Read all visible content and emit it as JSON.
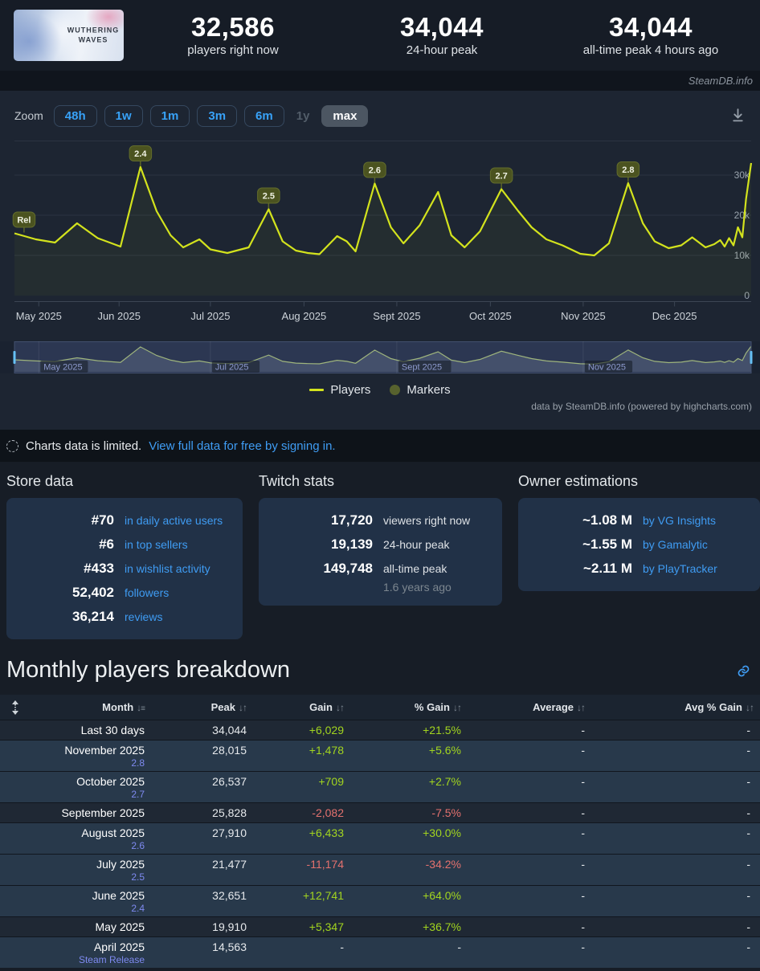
{
  "header": {
    "game_title": "WUTHERING WAVES",
    "watermark": "SteamDB.info",
    "stats": [
      {
        "value": "32,586",
        "label": "players right now"
      },
      {
        "value": "34,044",
        "label": "24-hour peak"
      },
      {
        "value": "34,044",
        "label": "all-time peak 4 hours ago"
      }
    ]
  },
  "chart": {
    "zoom_label": "Zoom",
    "zoom_buttons": [
      {
        "label": "48h",
        "state": "enabled"
      },
      {
        "label": "1w",
        "state": "enabled"
      },
      {
        "label": "1m",
        "state": "enabled"
      },
      {
        "label": "3m",
        "state": "enabled"
      },
      {
        "label": "6m",
        "state": "enabled"
      },
      {
        "label": "1y",
        "state": "disabled"
      },
      {
        "label": "max",
        "state": "selected"
      }
    ],
    "credits": "data by SteamDB.info (powered by highcharts.com)",
    "legend": [
      {
        "label": "Players",
        "type": "line"
      },
      {
        "label": "Markers",
        "type": "marker"
      }
    ]
  },
  "chart_data": {
    "type": "line",
    "title": "",
    "ylabel": "",
    "xrange": [
      "Apr 2025",
      "Dec 2025"
    ],
    "ylim": [
      0,
      38000
    ],
    "yticks": [
      0,
      10000,
      20000,
      30000
    ],
    "ytick_labels": [
      "0",
      "10k",
      "20k",
      "30k"
    ],
    "xticks": [
      0.033,
      0.142,
      0.266,
      0.393,
      0.519,
      0.646,
      0.772,
      0.896
    ],
    "xtick_labels": [
      "May 2025",
      "Jun 2025",
      "Jul 2025",
      "Aug 2025",
      "Sept 2025",
      "Oct 2025",
      "Nov 2025",
      "Dec 2025"
    ],
    "series": [
      {
        "name": "Players",
        "points": [
          [
            0.0,
            15500
          ],
          [
            0.029,
            14000
          ],
          [
            0.055,
            13200
          ],
          [
            0.085,
            18000
          ],
          [
            0.113,
            14300
          ],
          [
            0.144,
            12200
          ],
          [
            0.171,
            32000
          ],
          [
            0.193,
            21000
          ],
          [
            0.212,
            15000
          ],
          [
            0.229,
            12000
          ],
          [
            0.251,
            14000
          ],
          [
            0.266,
            11500
          ],
          [
            0.289,
            10600
          ],
          [
            0.318,
            12000
          ],
          [
            0.345,
            21500
          ],
          [
            0.364,
            13500
          ],
          [
            0.382,
            11200
          ],
          [
            0.398,
            10600
          ],
          [
            0.414,
            10300
          ],
          [
            0.438,
            14800
          ],
          [
            0.451,
            13500
          ],
          [
            0.463,
            11000
          ],
          [
            0.489,
            27900
          ],
          [
            0.511,
            17000
          ],
          [
            0.528,
            13000
          ],
          [
            0.55,
            17500
          ],
          [
            0.575,
            25800
          ],
          [
            0.593,
            15000
          ],
          [
            0.611,
            12000
          ],
          [
            0.632,
            16000
          ],
          [
            0.661,
            26500
          ],
          [
            0.684,
            21000
          ],
          [
            0.702,
            17000
          ],
          [
            0.722,
            14000
          ],
          [
            0.744,
            12500
          ],
          [
            0.768,
            10400
          ],
          [
            0.787,
            10000
          ],
          [
            0.807,
            13000
          ],
          [
            0.833,
            28000
          ],
          [
            0.853,
            18000
          ],
          [
            0.869,
            13500
          ],
          [
            0.888,
            11800
          ],
          [
            0.905,
            12500
          ],
          [
            0.92,
            14500
          ],
          [
            0.938,
            12000
          ],
          [
            0.95,
            12800
          ],
          [
            0.958,
            13800
          ],
          [
            0.964,
            12200
          ],
          [
            0.97,
            14300
          ],
          [
            0.976,
            12500
          ],
          [
            0.982,
            17000
          ],
          [
            0.988,
            14500
          ],
          [
            0.993,
            24000
          ],
          [
            1.0,
            33000
          ]
        ]
      }
    ],
    "markers": [
      {
        "label": "Rel",
        "frac": 0.013,
        "value": 15500
      },
      {
        "label": "2.4",
        "frac": 0.171,
        "value": 32000
      },
      {
        "label": "2.5",
        "frac": 0.345,
        "value": 21500
      },
      {
        "label": "2.6",
        "frac": 0.489,
        "value": 27900
      },
      {
        "label": "2.7",
        "frac": 0.661,
        "value": 26500
      },
      {
        "label": "2.8",
        "frac": 0.833,
        "value": 28000
      }
    ],
    "navigator_labels": [
      {
        "label": "May 2025",
        "frac": 0.033
      },
      {
        "label": "Jul 2025",
        "frac": 0.266
      },
      {
        "label": "Sept 2025",
        "frac": 0.519
      },
      {
        "label": "Nov 2025",
        "frac": 0.772
      }
    ]
  },
  "limited_banner": {
    "text": "Charts data is limited.",
    "link": "View full data for free by signing in."
  },
  "sections": {
    "store": {
      "title": "Store data",
      "rows": [
        {
          "value": "#70",
          "label": "in daily active users"
        },
        {
          "value": "#6",
          "label": "in top sellers"
        },
        {
          "value": "#433",
          "label": "in wishlist activity"
        },
        {
          "value": "52,402",
          "label": "followers"
        },
        {
          "value": "36,214",
          "label": "reviews"
        }
      ]
    },
    "twitch": {
      "title": "Twitch stats",
      "rows": [
        {
          "value": "17,720",
          "label": "viewers right now"
        },
        {
          "value": "19,139",
          "label": "24-hour peak"
        },
        {
          "value": "149,748",
          "label": "all-time peak",
          "sub": "1.6 years ago"
        }
      ]
    },
    "owners": {
      "title": "Owner estimations",
      "rows": [
        {
          "value": "~1.08 M",
          "label": "by VG Insights"
        },
        {
          "value": "~1.55 M",
          "label": "by Gamalytic"
        },
        {
          "value": "~2.11 M",
          "label": "by PlayTracker"
        }
      ]
    }
  },
  "breakdown": {
    "title": "Monthly players breakdown",
    "columns": [
      {
        "label": "Month",
        "sort": "desc"
      },
      {
        "label": "Peak",
        "sort": "both"
      },
      {
        "label": "Gain",
        "sort": "both"
      },
      {
        "label": "% Gain",
        "sort": "both"
      },
      {
        "label": "Average",
        "sort": "both"
      },
      {
        "label": "Avg % Gain",
        "sort": "both"
      }
    ],
    "rows": [
      {
        "month": "Last 30 days",
        "sub": "",
        "peak": "34,044",
        "gain": "+6,029",
        "pct": "+21.5%",
        "avg": "-",
        "avgpct": "-"
      },
      {
        "month": "November 2025",
        "sub": "2.8",
        "peak": "28,015",
        "gain": "+1,478",
        "pct": "+5.6%",
        "avg": "-",
        "avgpct": "-"
      },
      {
        "month": "October 2025",
        "sub": "2.7",
        "peak": "26,537",
        "gain": "+709",
        "pct": "+2.7%",
        "avg": "-",
        "avgpct": "-"
      },
      {
        "month": "September 2025",
        "sub": "",
        "peak": "25,828",
        "gain": "-2,082",
        "pct": "-7.5%",
        "avg": "-",
        "avgpct": "-"
      },
      {
        "month": "August 2025",
        "sub": "2.6",
        "peak": "27,910",
        "gain": "+6,433",
        "pct": "+30.0%",
        "avg": "-",
        "avgpct": "-"
      },
      {
        "month": "July 2025",
        "sub": "2.5",
        "peak": "21,477",
        "gain": "-11,174",
        "pct": "-34.2%",
        "avg": "-",
        "avgpct": "-"
      },
      {
        "month": "June 2025",
        "sub": "2.4",
        "peak": "32,651",
        "gain": "+12,741",
        "pct": "+64.0%",
        "avg": "-",
        "avgpct": "-"
      },
      {
        "month": "May 2025",
        "sub": "",
        "peak": "19,910",
        "gain": "+5,347",
        "pct": "+36.7%",
        "avg": "-",
        "avgpct": "-"
      },
      {
        "month": "April 2025",
        "sub": "Steam Release",
        "peak": "14,563",
        "gain": "-",
        "pct": "-",
        "avg": "-",
        "avgpct": "-"
      }
    ]
  },
  "colors": {
    "accent_blue": "#3f9cf3",
    "chart_line": "#d3e31d",
    "marker_pill": "#4b5320",
    "gain_positive": "#a2d41f",
    "gain_negative": "#e4716e",
    "milestone_label": "#7e8af0",
    "navigator_mask": "rgba(95,115,175,0.27)"
  }
}
